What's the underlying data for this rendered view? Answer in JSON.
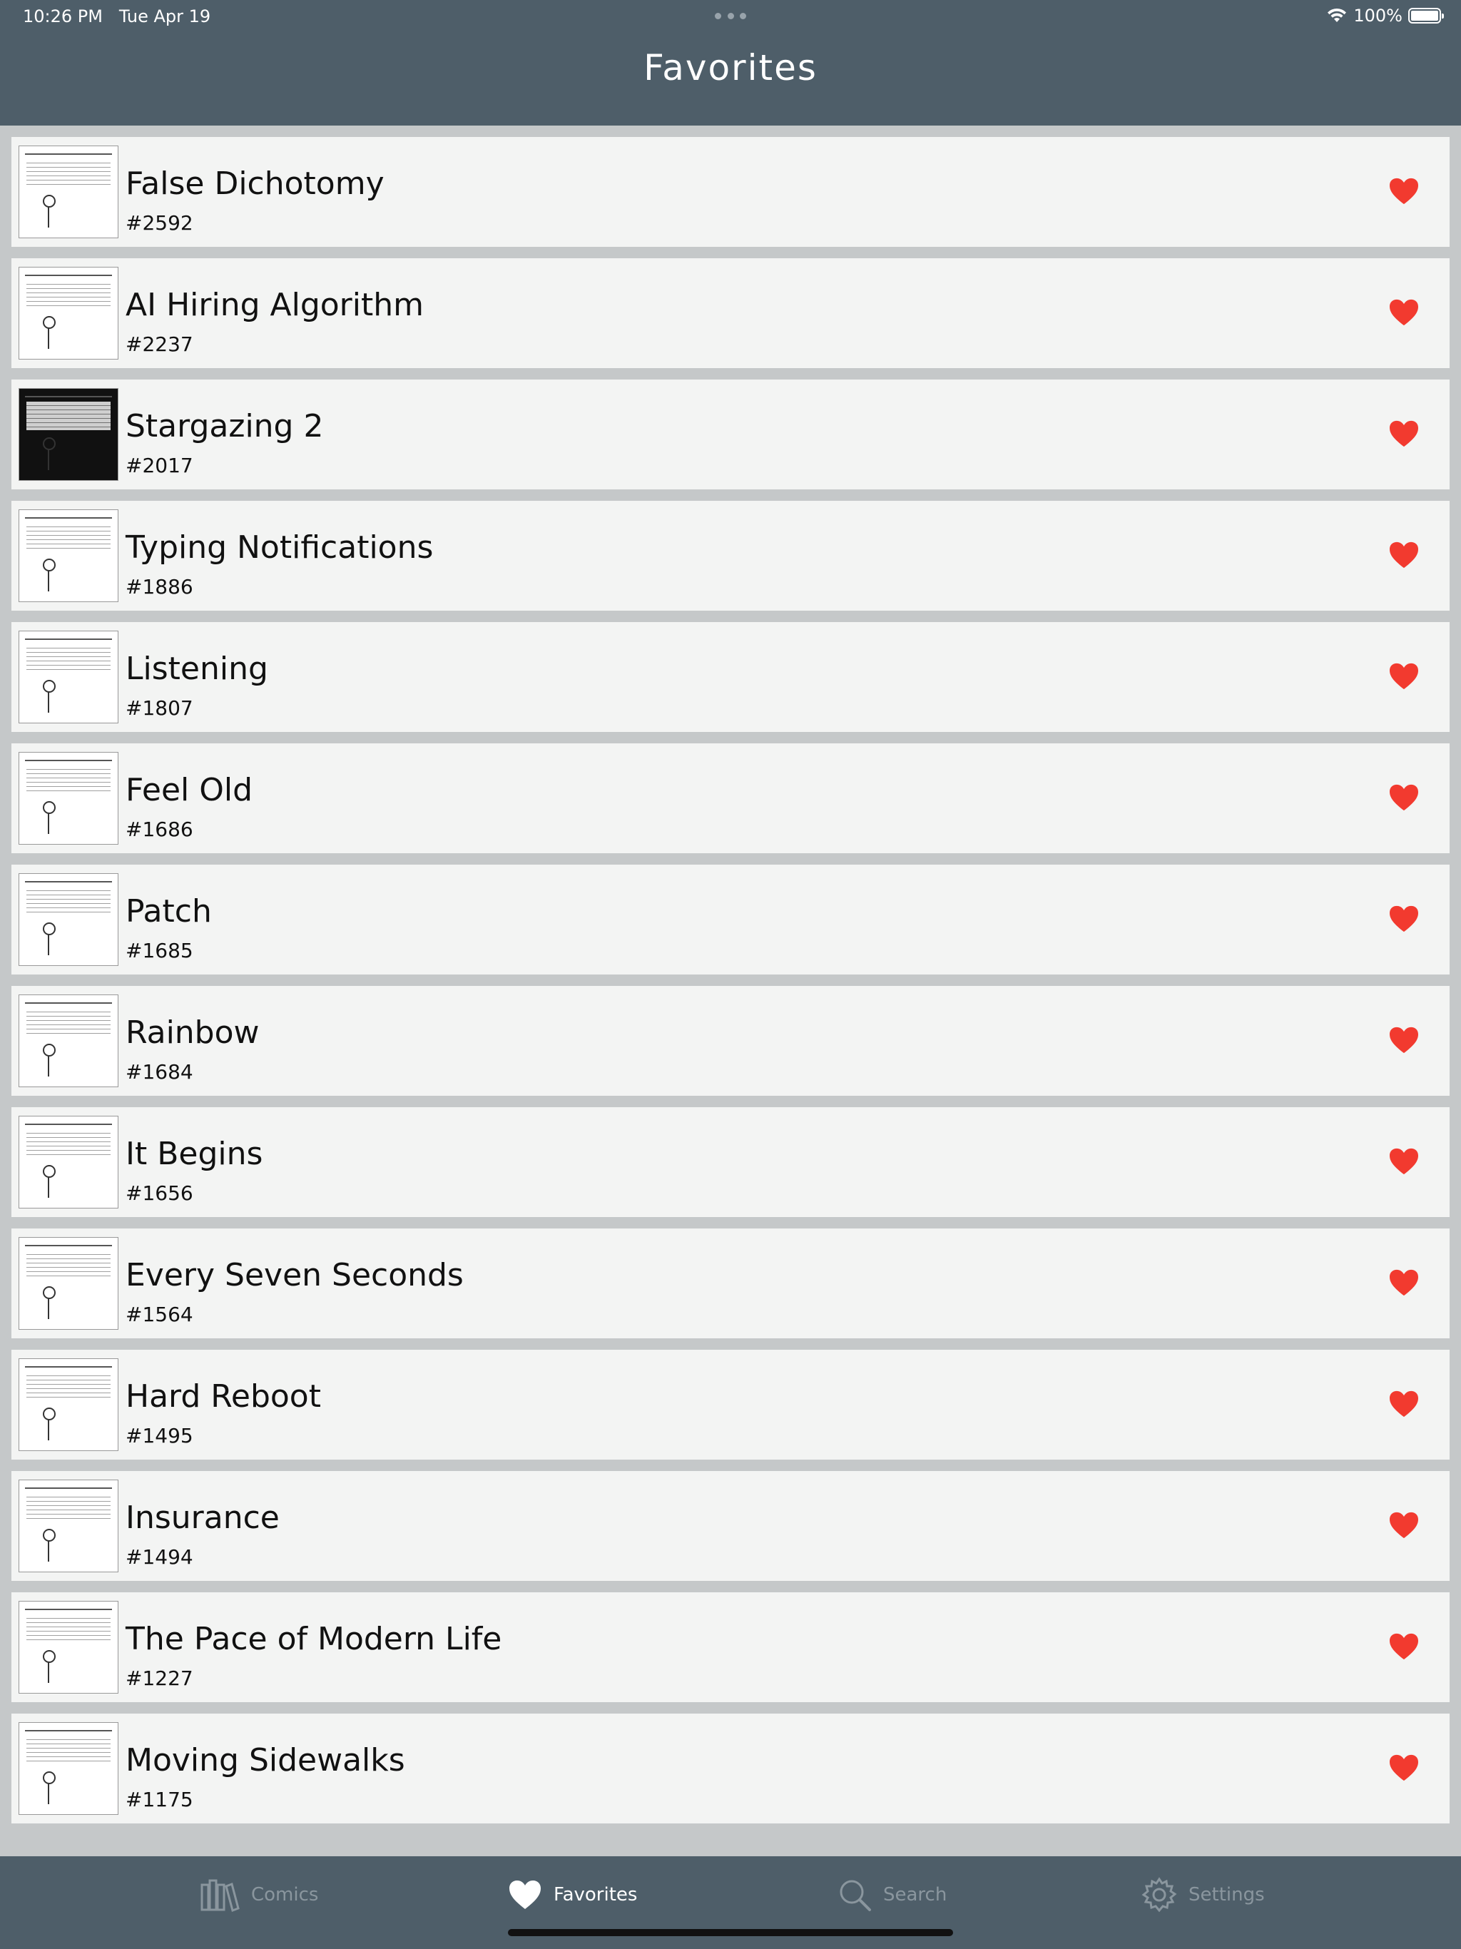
{
  "status_bar": {
    "time": "10:26 PM",
    "date": "Tue Apr 19",
    "battery": "100%"
  },
  "nav": {
    "title": "Favorites"
  },
  "favorites": [
    {
      "title": "False Dichotomy",
      "number": "#2592"
    },
    {
      "title": "AI Hiring Algorithm",
      "number": "#2237"
    },
    {
      "title": "Stargazing 2",
      "number": "#2017"
    },
    {
      "title": "Typing Notifications",
      "number": "#1886"
    },
    {
      "title": "Listening",
      "number": "#1807"
    },
    {
      "title": "Feel Old",
      "number": "#1686"
    },
    {
      "title": "Patch",
      "number": "#1685"
    },
    {
      "title": "Rainbow",
      "number": "#1684"
    },
    {
      "title": "It Begins",
      "number": "#1656"
    },
    {
      "title": "Every Seven Seconds",
      "number": "#1564"
    },
    {
      "title": "Hard Reboot",
      "number": "#1495"
    },
    {
      "title": "Insurance",
      "number": "#1494"
    },
    {
      "title": "The Pace of Modern Life",
      "number": "#1227"
    },
    {
      "title": "Moving Sidewalks",
      "number": "#1175"
    }
  ],
  "tab_bar": {
    "tabs": [
      {
        "label": "Comics",
        "icon": "books-icon",
        "active": false
      },
      {
        "label": "Favorites",
        "icon": "heart-icon",
        "active": true
      },
      {
        "label": "Search",
        "icon": "magnifier-icon",
        "active": false
      },
      {
        "label": "Settings",
        "icon": "gear-icon",
        "active": false
      }
    ]
  },
  "colors": {
    "header_bg": "#4e5e69",
    "row_bg": "#f3f4f3",
    "heart": "#f23a2f",
    "tab_active": "#ffffff",
    "tab_inactive": "#8a969e"
  }
}
